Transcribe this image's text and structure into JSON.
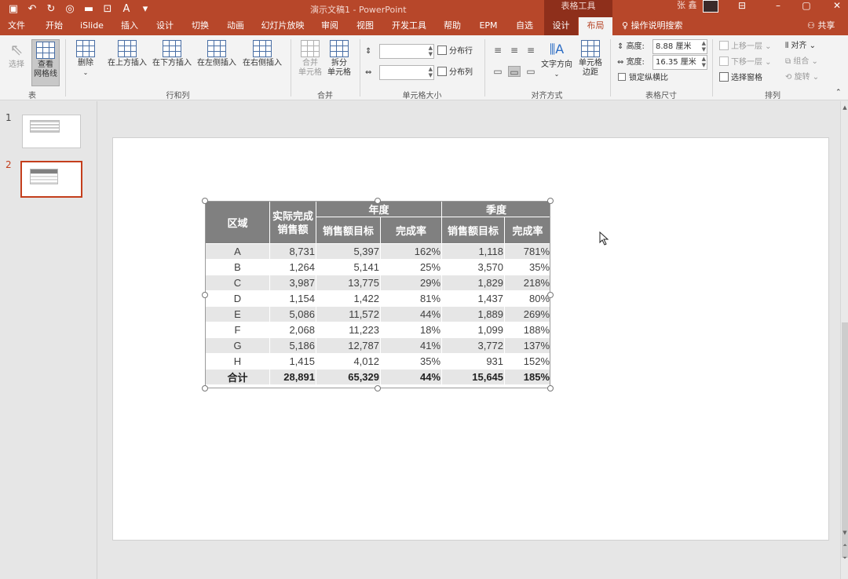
{
  "window": {
    "title": "演示文稿1 - PowerPoint",
    "context_tool": "表格工具",
    "user": "张 鑫"
  },
  "tabs": [
    "文件",
    "开始",
    "iSlide",
    "插入",
    "设计",
    "切换",
    "动画",
    "幻灯片放映",
    "审阅",
    "视图",
    "开发工具",
    "帮助",
    "EPM",
    "自选"
  ],
  "context_tabs": [
    "设计",
    "布局"
  ],
  "active_tab": "布局",
  "tell_me": "操作说明搜索",
  "share": "共享",
  "ribbon": {
    "groups": {
      "table": "表",
      "rows_cols": "行和列",
      "merge": "合并",
      "cell_size": "单元格大小",
      "alignment": "对齐方式",
      "table_size": "表格尺寸",
      "arrange": "排列"
    },
    "select": "选择",
    "view_gridlines": [
      "查看",
      "网格线"
    ],
    "delete": "删除",
    "insert_above": "在上方插入",
    "insert_below": "在下方插入",
    "insert_left": "在左侧插入",
    "insert_right": "在右侧插入",
    "merge_cells": [
      "合并",
      "单元格"
    ],
    "split_cells": [
      "拆分",
      "单元格"
    ],
    "distribute_rows": "分布行",
    "distribute_cols": "分布列",
    "text_direction": "文字方向",
    "cell_margins": [
      "单元格",
      "边距"
    ],
    "height_label": "高度:",
    "height_value": "8.88 厘米",
    "width_label": "宽度:",
    "width_value": "16.35 厘米",
    "lock_ratio": "锁定纵横比",
    "bring_forward": "上移一层",
    "send_backward": "下移一层",
    "selection_pane": "选择窗格",
    "align": "对齐",
    "group": "组合",
    "rotate": "旋转"
  },
  "slides": [
    {
      "num": "1"
    },
    {
      "num": "2"
    }
  ],
  "table": {
    "header": {
      "region": "区域",
      "actual": "实际完成销售额",
      "annual": "年度",
      "quarterly": "季度",
      "target": "销售额目标",
      "rate": "完成率"
    },
    "rows": [
      {
        "region": "A",
        "actual": "8,731",
        "y_target": "5,397",
        "y_rate": "162%",
        "q_target": "1,118",
        "q_rate": "781%"
      },
      {
        "region": "B",
        "actual": "1,264",
        "y_target": "5,141",
        "y_rate": "25%",
        "q_target": "3,570",
        "q_rate": "35%"
      },
      {
        "region": "C",
        "actual": "3,987",
        "y_target": "13,775",
        "y_rate": "29%",
        "q_target": "1,829",
        "q_rate": "218%"
      },
      {
        "region": "D",
        "actual": "1,154",
        "y_target": "1,422",
        "y_rate": "81%",
        "q_target": "1,437",
        "q_rate": "80%"
      },
      {
        "region": "E",
        "actual": "5,086",
        "y_target": "11,572",
        "y_rate": "44%",
        "q_target": "1,889",
        "q_rate": "269%"
      },
      {
        "region": "F",
        "actual": "2,068",
        "y_target": "11,223",
        "y_rate": "18%",
        "q_target": "1,099",
        "q_rate": "188%"
      },
      {
        "region": "G",
        "actual": "5,186",
        "y_target": "12,787",
        "y_rate": "41%",
        "q_target": "3,772",
        "q_rate": "137%"
      },
      {
        "region": "H",
        "actual": "1,415",
        "y_target": "4,012",
        "y_rate": "35%",
        "q_target": "931",
        "q_rate": "152%"
      }
    ],
    "total": {
      "region": "合计",
      "actual": "28,891",
      "y_target": "65,329",
      "y_rate": "44%",
      "q_target": "15,645",
      "q_rate": "185%"
    }
  },
  "colors": {
    "accent": "#b7472a",
    "context": "#8e2f1b",
    "header_fill": "#808080",
    "band_fill": "#e6e6e6"
  }
}
